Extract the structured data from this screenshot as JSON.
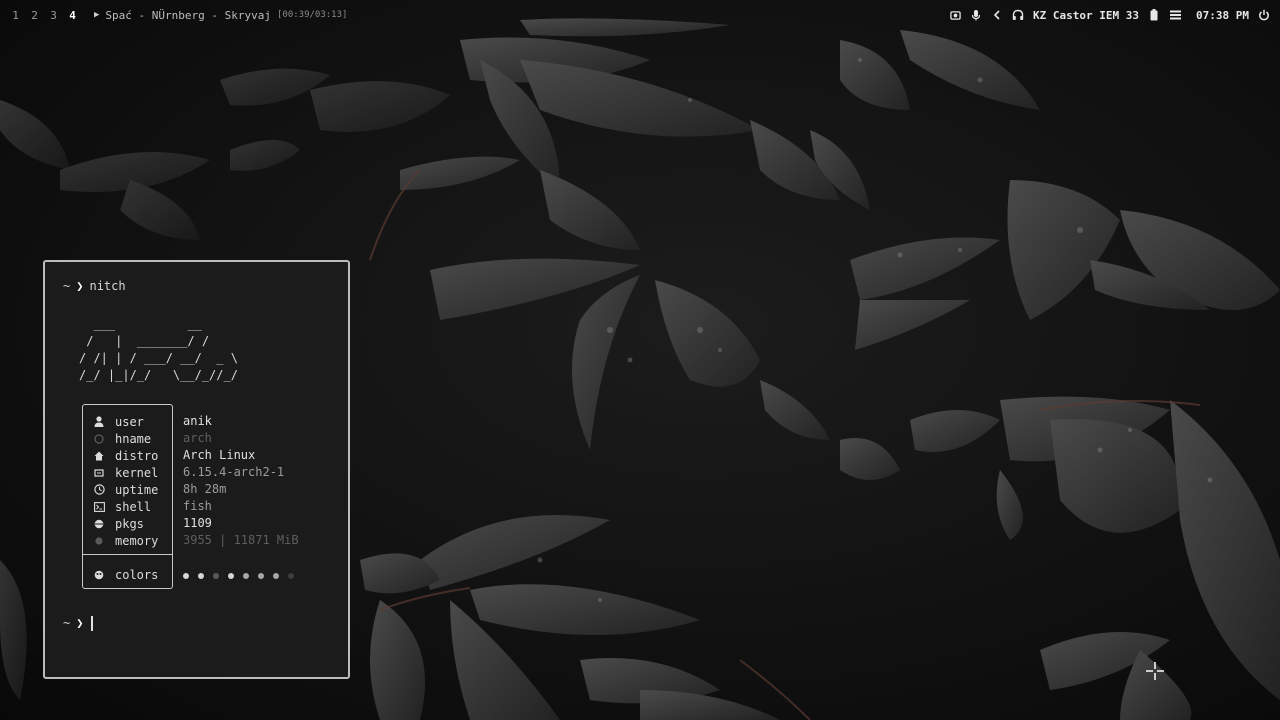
{
  "topbar": {
    "workspaces": [
      "1",
      "2",
      "3",
      "4"
    ],
    "active_workspace": "4",
    "media_title": "Spać - NÜrnberg - Skryvaj",
    "media_time": "[00:39/03:13]",
    "media_icon": "play-icon",
    "tray_icons": [
      "screen-record-icon",
      "microphone-icon",
      "chevron-left-icon",
      "headphones-icon",
      "battery-icon",
      "menu-icon",
      "power-icon"
    ],
    "device_name": "KZ Castor IEM 33",
    "clock": "07:38 PM"
  },
  "terminal": {
    "command_prompt": "~",
    "command": "nitch",
    "second_prompt": "~",
    "ascii_art": "  ___          __\n /   |  _______/ /\n/ /| | / ___/ __/  _ \\\n/_/ |_|/_/   \\__/_//_/",
    "info": [
      {
        "label": "user",
        "value": "anik",
        "icon": "user-icon"
      },
      {
        "label": "hname",
        "value": "arch",
        "icon": "host-icon"
      },
      {
        "label": "distro",
        "value": "Arch Linux",
        "icon": "distro-icon"
      },
      {
        "label": "kernel",
        "value": "6.15.4-arch2-1",
        "icon": "kernel-icon"
      },
      {
        "label": "uptime",
        "value": "8h 28m",
        "icon": "clock-icon"
      },
      {
        "label": "shell",
        "value": "fish",
        "icon": "shell-icon"
      },
      {
        "label": "pkgs",
        "value": "1109",
        "icon": "package-icon"
      },
      {
        "label": "memory",
        "value": "3955 | 11871 MiB",
        "icon": "memory-icon"
      }
    ],
    "colors_label": "colors",
    "color_dots": [
      "#d6d6d6",
      "#d6d6d6",
      "#5a5a5a",
      "#d6d6d6",
      "#a8a8a8",
      "#a8a8a8",
      "#a8a8a8",
      "#3c3c3c"
    ]
  }
}
